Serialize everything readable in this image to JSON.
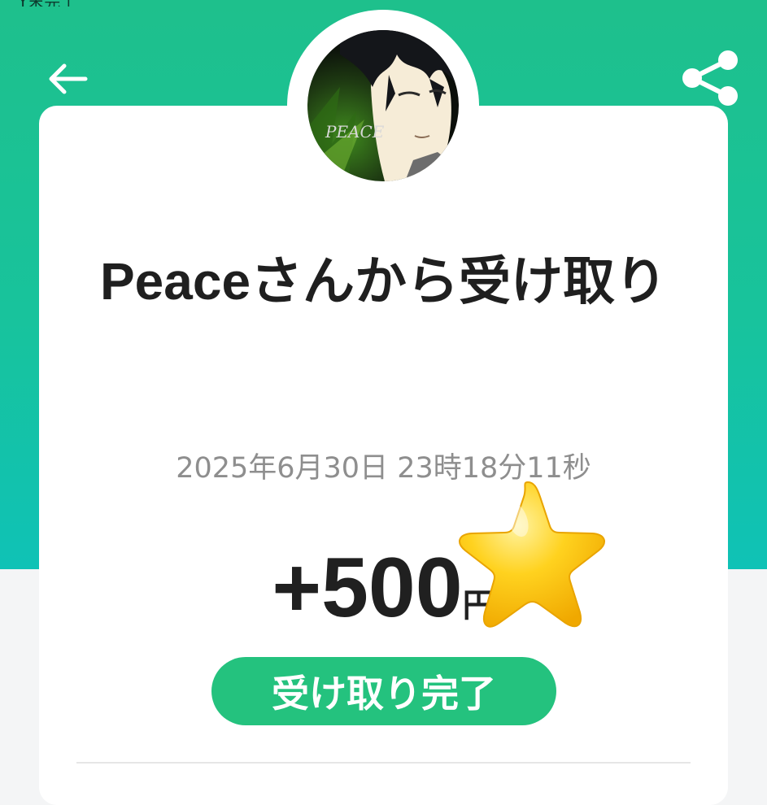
{
  "theme": {
    "header_gradient_top": "#1ec08c",
    "header_gradient_bottom": "#0fc2b6",
    "badge_color": "#24c27e",
    "page_background": "#f4f5f6"
  },
  "status_bar": {
    "fragment": "Y末完了"
  },
  "header": {
    "back_icon": "arrow-left-icon",
    "share_icon": "share-icon"
  },
  "sender": {
    "avatar_text": "PEACE"
  },
  "transaction": {
    "title": "Peaceさんから受け取り",
    "timestamp": "2025年6月30日 23時18分11秒",
    "amount": "+500",
    "amount_unit": "円",
    "status": "受け取り完了"
  },
  "sticker": {
    "icon": "star-icon"
  }
}
